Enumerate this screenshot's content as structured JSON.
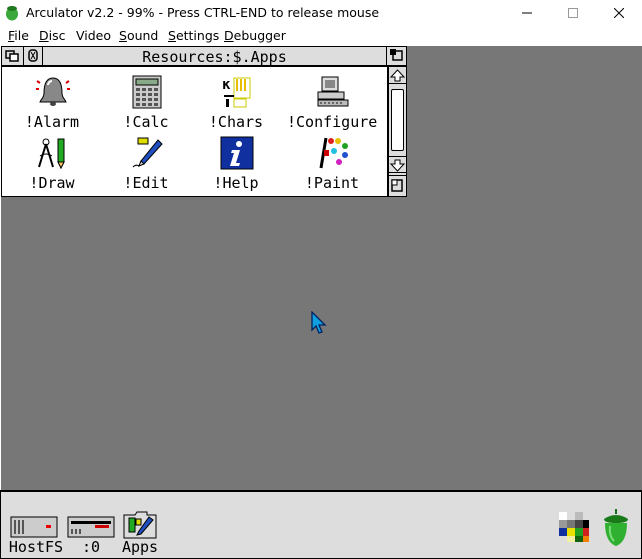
{
  "window": {
    "title": "Arculator v2.2 - 99% - Press CTRL-END to release mouse",
    "icon": "acorn-icon",
    "controls": [
      "minimize-icon",
      "maximize-icon",
      "close-icon"
    ]
  },
  "menubar": {
    "items": [
      {
        "label": "File",
        "accel": "F",
        "rest": "ile"
      },
      {
        "label": "Disc",
        "accel": "D",
        "rest": "isc"
      },
      {
        "label": "Video",
        "accel": "",
        "rest": "Video"
      },
      {
        "label": "Sound",
        "accel": "S",
        "rest": "ound"
      },
      {
        "label": "Settings",
        "accel": "S",
        "rest": "ettings"
      },
      {
        "label": "Debugger",
        "accel": "D",
        "rest": "ebugger"
      }
    ]
  },
  "filer": {
    "title": "Resources:$.Apps",
    "apps": [
      {
        "label": "!Alarm",
        "icon": "bell-icon"
      },
      {
        "label": "!Calc",
        "icon": "calculator-icon"
      },
      {
        "label": "!Chars",
        "icon": "characters-icon"
      },
      {
        "label": "!Configure",
        "icon": "computer-icon"
      },
      {
        "label": "!Draw",
        "icon": "compass-pen-icon"
      },
      {
        "label": "!Edit",
        "icon": "pen-icon"
      },
      {
        "label": "!Help",
        "icon": "info-icon"
      },
      {
        "label": "!Paint",
        "icon": "palette-icon"
      }
    ]
  },
  "iconbar": {
    "left": [
      {
        "label": "HostFS",
        "icon": "hard-drive-icon"
      },
      {
        "label": ":0",
        "icon": "floppy-drive-icon"
      },
      {
        "label": "Apps",
        "icon": "apps-folder-icon"
      }
    ],
    "right": [
      {
        "icon": "display-manager-icon"
      },
      {
        "icon": "acorn-task-manager-icon"
      }
    ]
  },
  "colors": {
    "desktop": "#777777",
    "iconbar": "#dddddd",
    "window_tool": "#dddddd",
    "acorn_green": "#2e9e2e",
    "help_blue": "#1030a0"
  }
}
